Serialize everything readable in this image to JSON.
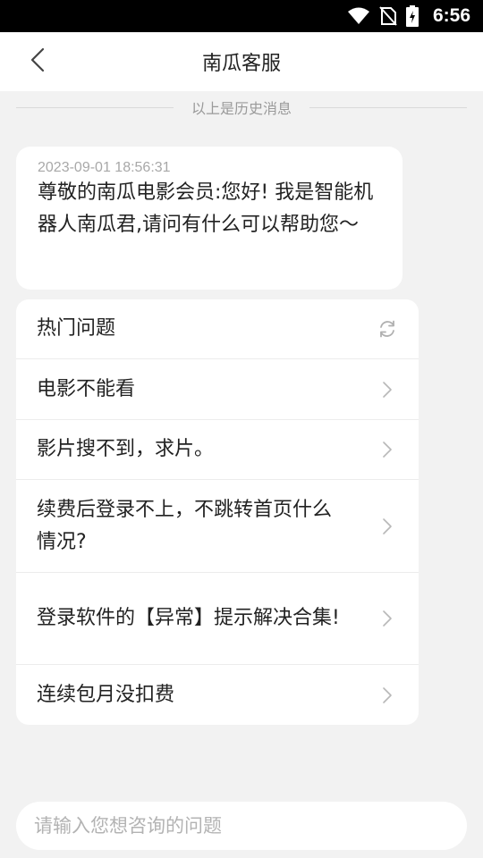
{
  "status_bar": {
    "time": "6:56",
    "icons": [
      "wifi-icon",
      "no-sim-icon",
      "battery-charging-icon"
    ]
  },
  "header": {
    "title": "南瓜客服",
    "back_icon": "chevron-left-icon"
  },
  "history_divider": {
    "text": "以上是历史消息"
  },
  "bot_message": {
    "timestamp": "2023-09-01 18:56:31",
    "text": "尊敬的南瓜电影会员:您好! 我是智能机器人南瓜君,请问有什么可以帮助您～"
  },
  "faq": {
    "title": "热门问题",
    "refresh_icon": "refresh-icon",
    "items": [
      {
        "label": "电影不能看",
        "icon": "chevron-right-icon"
      },
      {
        "label": "影片搜不到，求片。",
        "icon": "chevron-right-icon"
      },
      {
        "label": "续费后登录不上，不跳转首页什么情况?",
        "icon": "chevron-right-icon"
      },
      {
        "label": "登录软件的【异常】提示解决合集!",
        "icon": "chevron-right-icon"
      },
      {
        "label": "连续包月没扣费",
        "icon": "chevron-right-icon"
      }
    ]
  },
  "input": {
    "placeholder": "请输入您想咨询的问题",
    "value": ""
  },
  "colors": {
    "background": "#f2f2f2",
    "card": "#ffffff",
    "text": "#222222",
    "muted": "#9a9a9a",
    "status_bar": "#000000"
  }
}
